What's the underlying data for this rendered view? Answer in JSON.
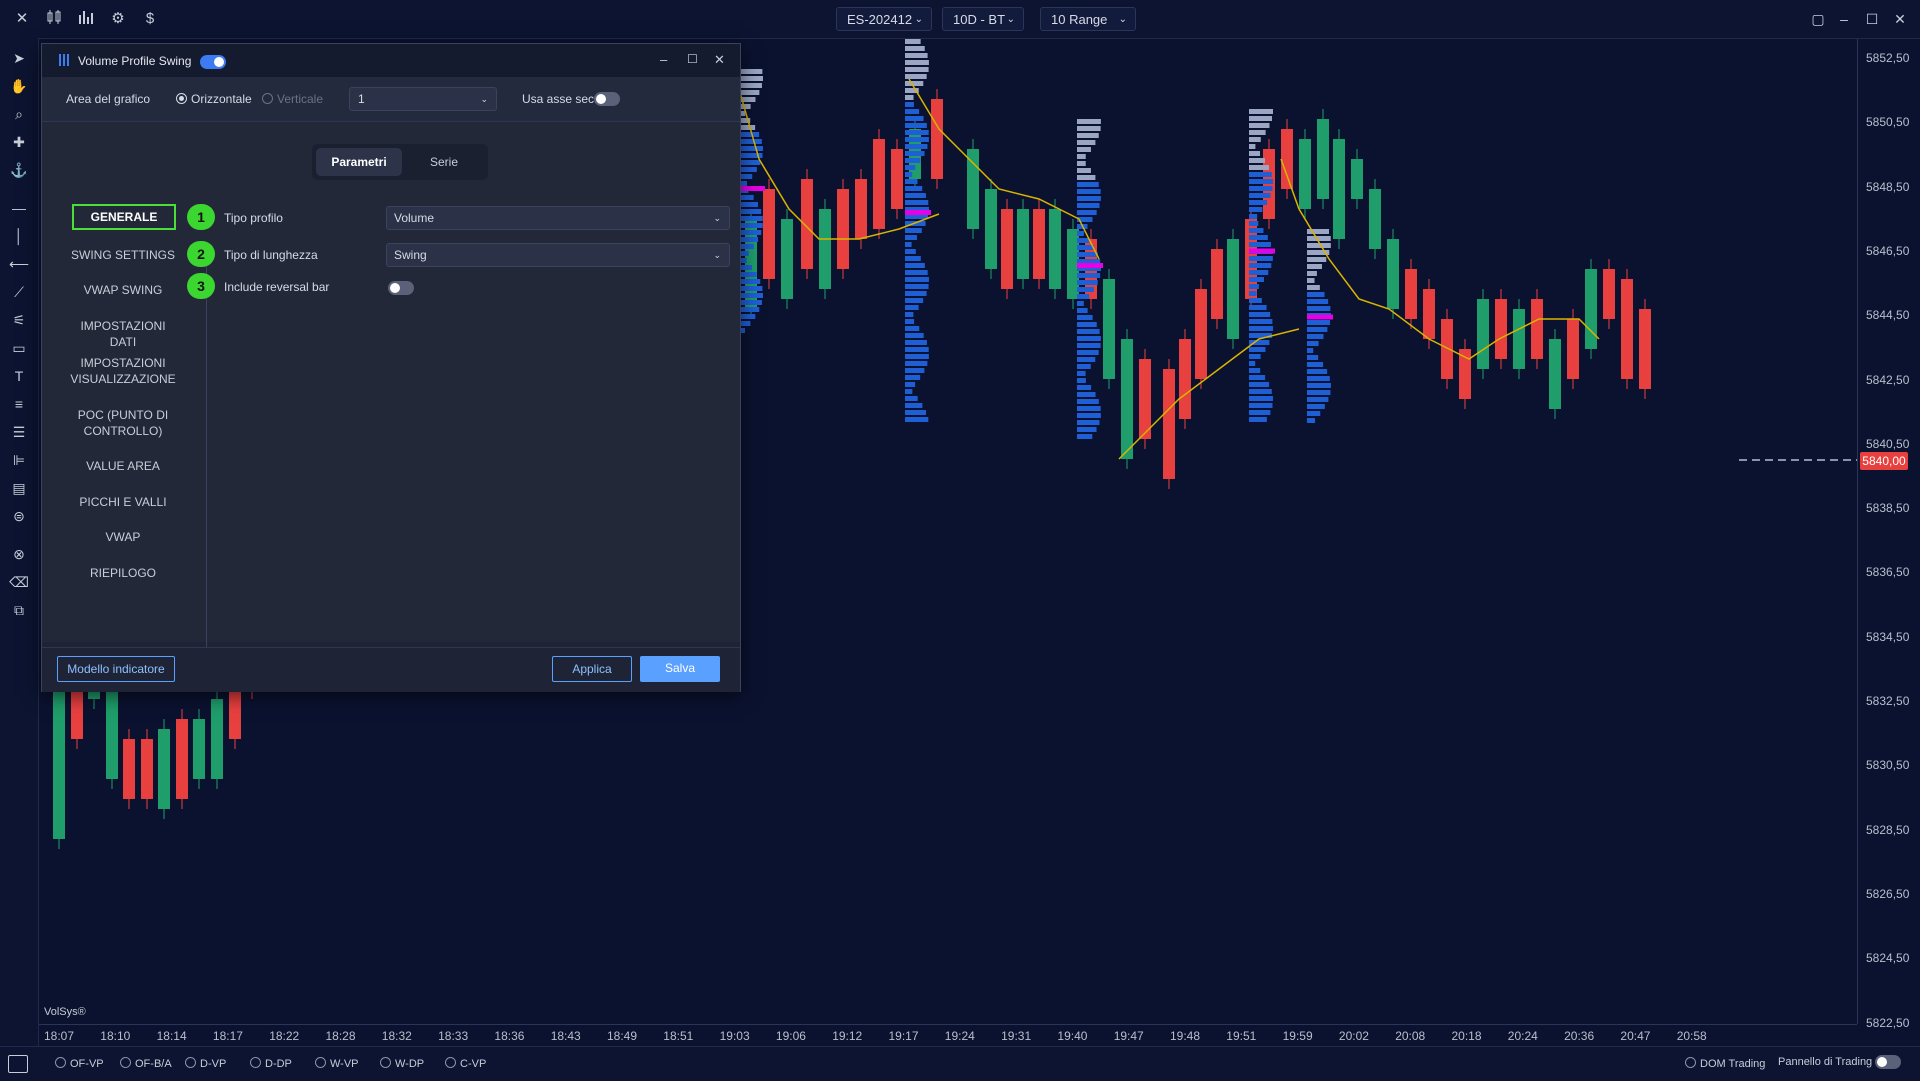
{
  "topbar": {
    "symbol": "ES-202412",
    "timeframe": "10D - BT",
    "bar_type": "10 Range",
    "icons": [
      "close-icon",
      "candles-icon",
      "bar-chart-icon",
      "settings-icon",
      "dollar-icon"
    ]
  },
  "dialog": {
    "title": "Volume Profile Swing",
    "enabled": true,
    "top_row": {
      "area_label": "Area del grafico",
      "opt_horizontal": "Orizzontale",
      "opt_vertical": "Verticale",
      "selected": "Orizzontale",
      "number_value": "1",
      "sec_axis_label": "Usa asse sec.",
      "sec_axis_on": false
    },
    "tabs": [
      "Parametri",
      "Serie"
    ],
    "active_tab": "Parametri",
    "nav": [
      "GENERALE",
      "SWING SETTINGS",
      "VWAP SWING",
      "IMPOSTAZIONI DATI",
      "IMPOSTAZIONI VISUALIZZAZIONE",
      "POC (PUNTO DI CONTROLLO)",
      "VALUE AREA",
      "PICCHI E VALLI",
      "VWAP",
      "RIEPILOGO"
    ],
    "active_nav": "GENERALE",
    "params": [
      {
        "num": "1",
        "label": "Tipo profilo",
        "value": "Volume",
        "kind": "select"
      },
      {
        "num": "2",
        "label": "Tipo di lunghezza",
        "value": "Swing",
        "kind": "select"
      },
      {
        "num": "3",
        "label": "Include reversal bar",
        "value": false,
        "kind": "toggle"
      }
    ],
    "footer": {
      "template": "Modello indicatore",
      "apply": "Applica",
      "save": "Salva"
    }
  },
  "chart": {
    "price_labels": [
      "5852,50",
      "5850,50",
      "5848,50",
      "5846,50",
      "5844,50",
      "5842,50",
      "5840,50",
      "5838,50",
      "5836,50",
      "5834,50",
      "5832,50",
      "5830,50",
      "5828,50",
      "5826,50",
      "5824,50",
      "5822,50"
    ],
    "last_price": "5840,00",
    "time_labels": [
      "18:07",
      "18:10",
      "18:14",
      "18:17",
      "18:22",
      "18:28",
      "18:32",
      "18:33",
      "18:36",
      "18:43",
      "18:49",
      "18:51",
      "19:03",
      "19:06",
      "19:12",
      "19:17",
      "19:24",
      "19:31",
      "19:40",
      "19:47",
      "19:48",
      "19:51",
      "19:59",
      "20:02",
      "20:08",
      "20:18",
      "20:24",
      "20:36",
      "20:47",
      "20:58"
    ],
    "brand": "VolSys®",
    "colors": {
      "up": "#1f9d6b",
      "down": "#e8403f",
      "profile": "#1f5fd6",
      "poc": "#e600e6",
      "vwap": "#d9b400"
    }
  },
  "bottombar": {
    "modes": [
      "OF-VP",
      "OF-B/A",
      "D-VP",
      "D-DP",
      "W-VP",
      "W-DP",
      "C-VP"
    ],
    "dom_label": "DOM Trading",
    "panel_label": "Pannello di Trading",
    "panel_on": false
  }
}
